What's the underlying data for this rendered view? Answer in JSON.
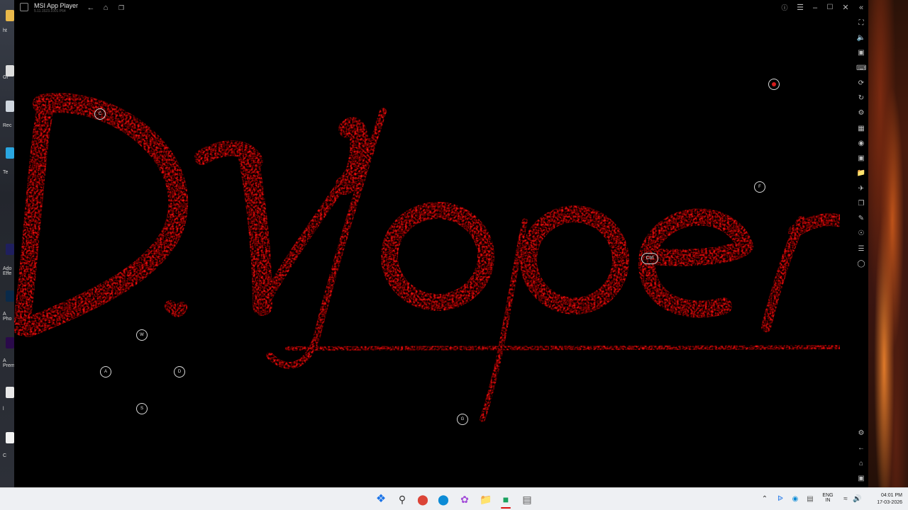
{
  "window": {
    "title": "MSI App Player",
    "version": "5.11.1523.1001 P64"
  },
  "desktop": {
    "labels": [
      "ht",
      "Gi",
      "Rec",
      "Te",
      "Ado\nEffe",
      "A\nPho",
      "A\nPrem",
      "l",
      "C"
    ]
  },
  "game_keys": {
    "c": "C",
    "f": "F",
    "ctrl": "Ctrl",
    "w": "W",
    "a": "A",
    "d": "D",
    "s": "S",
    "g": "G"
  },
  "canvas_text": "DVoper",
  "taskbar": {
    "language": "ENG",
    "region": "IN",
    "time": "04:01 PM",
    "date": "17-03-2026"
  },
  "colors": {
    "accent_red": "#ff0a0a",
    "taskbar_bg": "#eef0f3"
  }
}
